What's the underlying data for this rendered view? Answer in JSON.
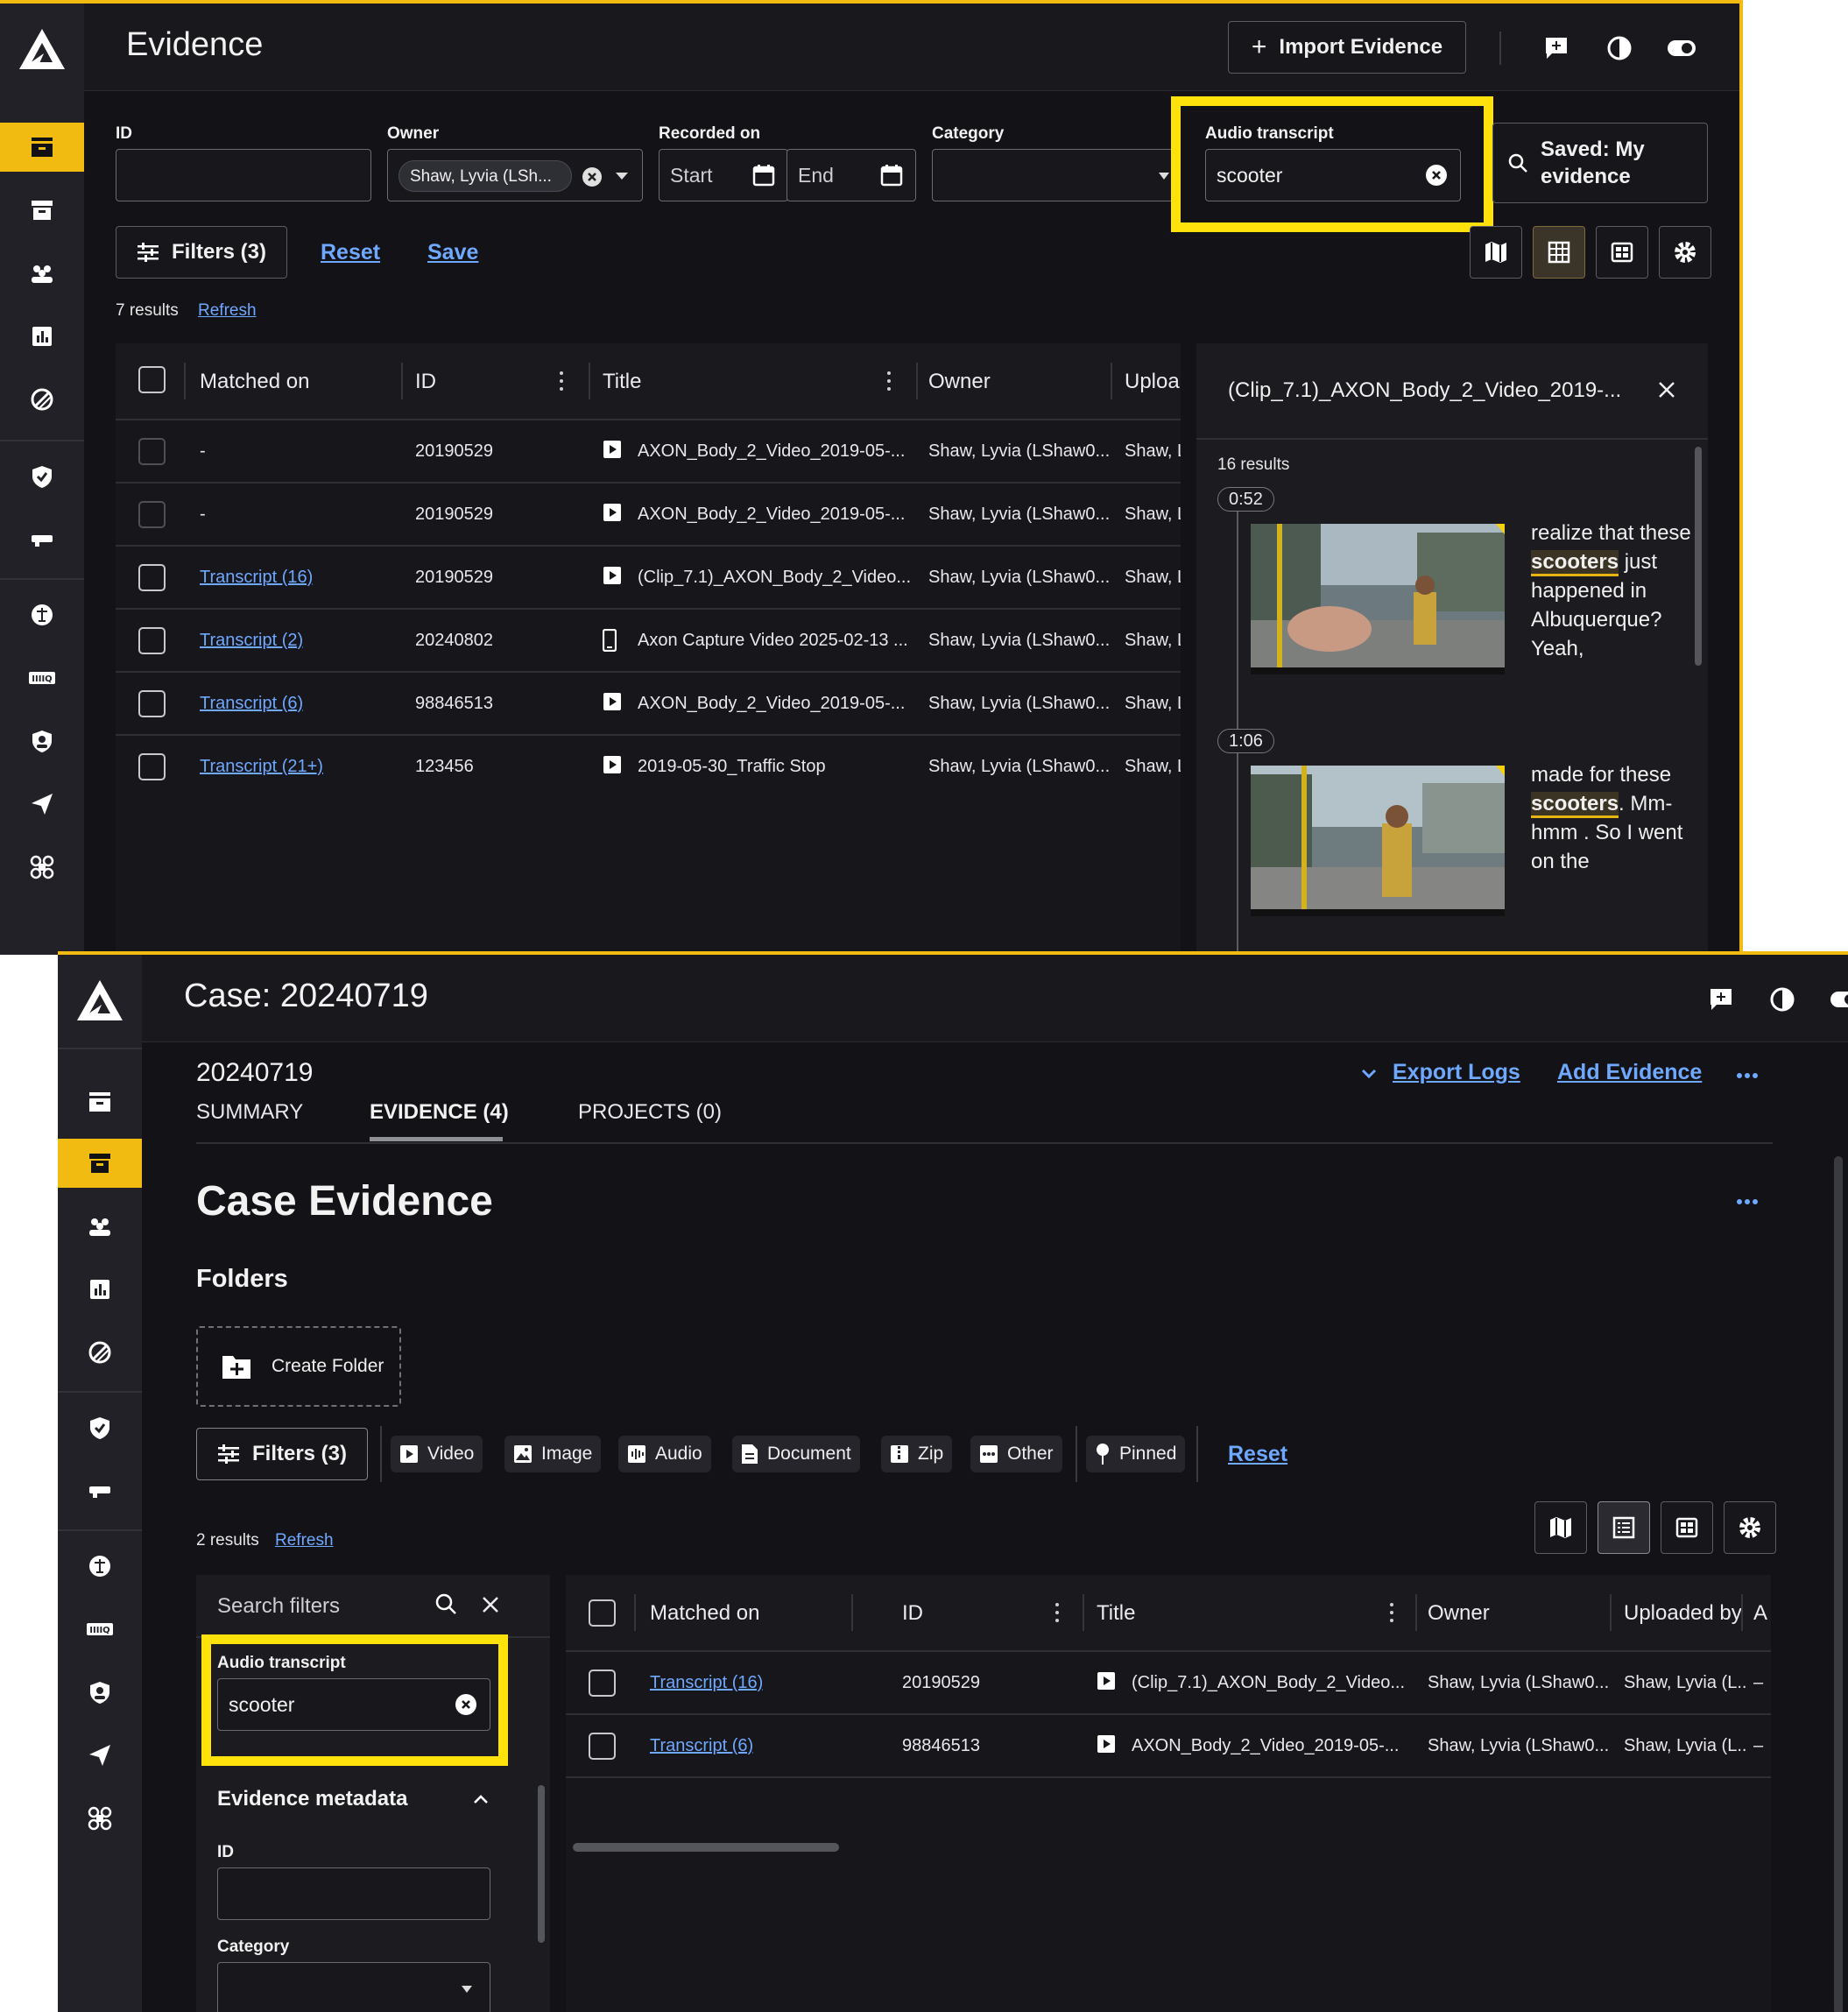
{
  "colors": {
    "accent": "#f1bb11",
    "highlight_box": "#ffe20c",
    "link": "#6fa8ff",
    "background": "#121217"
  },
  "evidence_window": {
    "title": "Evidence",
    "import_button": "Import Evidence",
    "filters": {
      "id_label": "ID",
      "owner_label": "Owner",
      "owner_value": "Shaw, Lyvia (LSh...",
      "recorded_label": "Recorded on",
      "start_placeholder": "Start",
      "end_placeholder": "End",
      "category_label": "Category",
      "audio_label": "Audio transcript",
      "audio_value": "scooter",
      "saved_line1": "Saved: My",
      "saved_line2": "evidence"
    },
    "filters_button": "Filters (3)",
    "reset": "Reset",
    "save": "Save",
    "results_count": "7 results",
    "refresh": "Refresh",
    "columns": [
      "Matched on",
      "ID",
      "Title",
      "Owner",
      "Uploa"
    ],
    "rows": [
      {
        "matched": "-",
        "id": "20190529",
        "title": "AXON_Body_2_Video_2019-05-...",
        "owner": "Shaw, Lyvia (LShaw0...",
        "uploaded": "Shaw, L",
        "icon": "video",
        "link": false,
        "disabled": true
      },
      {
        "matched": "-",
        "id": "20190529",
        "title": "AXON_Body_2_Video_2019-05-...",
        "owner": "Shaw, Lyvia (LShaw0...",
        "uploaded": "Shaw, L",
        "icon": "video",
        "link": false,
        "disabled": true
      },
      {
        "matched": "Transcript (16)",
        "id": "20190529",
        "title": "(Clip_7.1)_AXON_Body_2_Video...",
        "owner": "Shaw, Lyvia (LShaw0...",
        "uploaded": "Shaw, L",
        "icon": "video",
        "link": true,
        "disabled": false
      },
      {
        "matched": "Transcript (2)",
        "id": "20240802",
        "title": "Axon Capture Video 2025-02-13 ...",
        "owner": "Shaw, Lyvia (LShaw0...",
        "uploaded": "Shaw, L",
        "icon": "phone",
        "link": true,
        "disabled": false
      },
      {
        "matched": "Transcript (6)",
        "id": "98846513",
        "title": "AXON_Body_2_Video_2019-05-...",
        "owner": "Shaw, Lyvia (LShaw0...",
        "uploaded": "Shaw, L",
        "icon": "video",
        "link": true,
        "disabled": false
      },
      {
        "matched": "Transcript (21+)",
        "id": "123456",
        "title": "2019-05-30_Traffic Stop",
        "owner": "Shaw, Lyvia (LShaw0...",
        "uploaded": "Shaw, L",
        "icon": "video",
        "link": true,
        "disabled": false
      }
    ],
    "panel": {
      "title": "(Clip_7.1)_AXON_Body_2_Video_2019-...",
      "results": "16 results",
      "hits": [
        {
          "time": "0:52",
          "before": "realize that these ",
          "match": "scooters",
          "after": " just happened in Albuquerque? Yeah,"
        },
        {
          "time": "1:06",
          "before": "made for these ",
          "match": "scooters",
          "after": ". Mm-hmm . So I went on the"
        }
      ]
    }
  },
  "case_window": {
    "title": "Case: 20240719",
    "case_id": "20240719",
    "tabs": [
      "SUMMARY",
      "EVIDENCE (4)",
      "PROJECTS (0)"
    ],
    "export_logs": "Export Logs",
    "add_evidence": "Add Evidence",
    "heading": "Case Evidence",
    "folders_heading": "Folders",
    "create_folder": "Create Folder",
    "filters_button": "Filters (3)",
    "type_chips": [
      "Video",
      "Image",
      "Audio",
      "Document",
      "Zip",
      "Other"
    ],
    "pinned": "Pinned",
    "reset": "Reset",
    "results_count": "2 results",
    "refresh": "Refresh",
    "search_filters": "Search filters",
    "audio_label": "Audio transcript",
    "audio_value": "scooter",
    "metadata_heading": "Evidence metadata",
    "id_label": "ID",
    "category_label": "Category",
    "columns": [
      "Matched on",
      "ID",
      "Title",
      "Owner",
      "Uploaded by",
      "A"
    ],
    "rows": [
      {
        "matched": "Transcript (16)",
        "id": "20190529",
        "title": "(Clip_7.1)_AXON_Body_2_Video...",
        "owner": "Shaw, Lyvia (LShaw0...",
        "uploaded": "Shaw, Lyvia (L...",
        "extra": "–"
      },
      {
        "matched": "Transcript (6)",
        "id": "98846513",
        "title": "AXON_Body_2_Video_2019-05-...",
        "owner": "Shaw, Lyvia (LShaw0...",
        "uploaded": "Shaw, Lyvia (L...",
        "extra": "–"
      }
    ]
  }
}
